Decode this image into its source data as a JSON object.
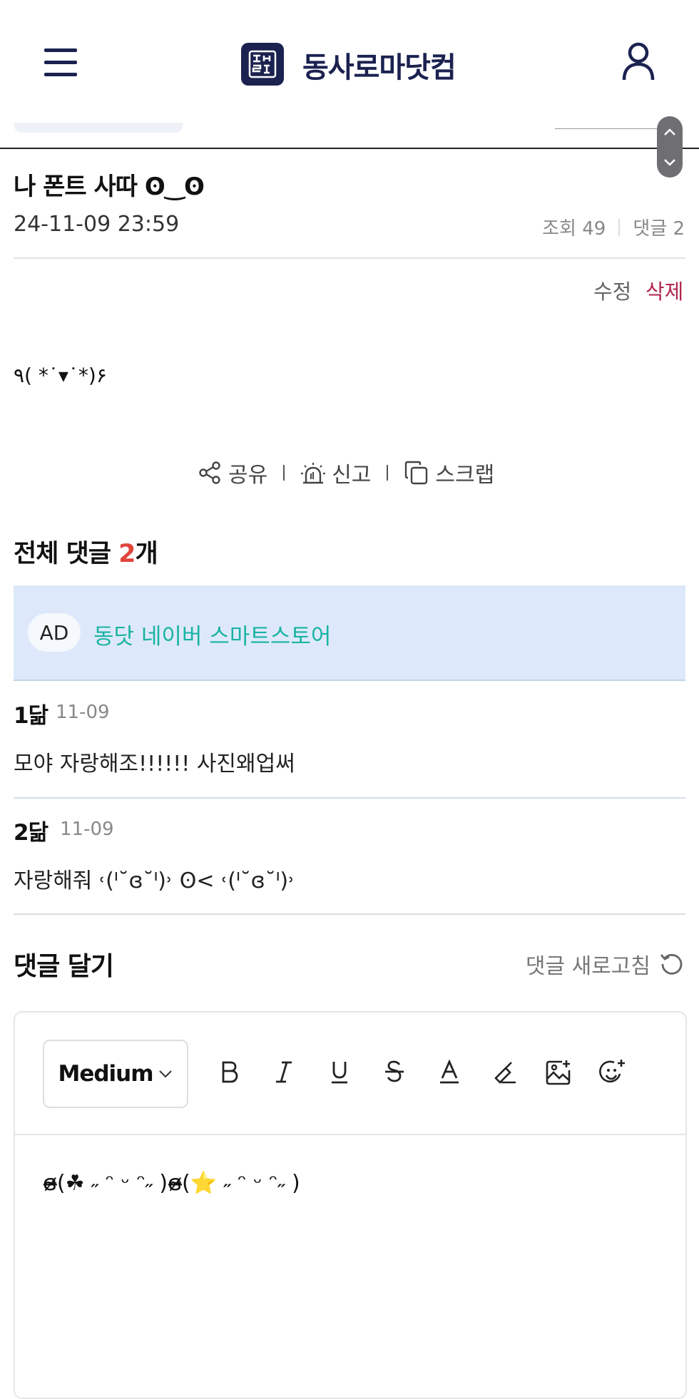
{
  "header": {
    "logo_mark": "동사\n로닷",
    "site_title": "동사로마닷컴"
  },
  "post": {
    "title": "나 폰트 사따 ʘ‿ʘ",
    "date": "24-11-09 23:59",
    "views_label": "조회 49",
    "comments_label": "댓글 2",
    "edit_label": "수정",
    "delete_label": "삭제",
    "body": "٩( *˙▾˙*)۶"
  },
  "actions": {
    "share": "공유",
    "report": "신고",
    "scrap": "스크랩"
  },
  "comments": {
    "heading_prefix": "전체 댓글 ",
    "count": "2",
    "heading_suffix": "개",
    "ad_badge": "AD",
    "ad_text": "동닷 네이버 스마트스토어",
    "items": [
      {
        "author": "1닮",
        "date": "11-09",
        "text": "모야 자랑해조!!!!!! 사진왜업써"
      },
      {
        "author": "2닮",
        "date": "11-09",
        "text": "자랑해줘 ˓(ᑊ˘ɞ˘ᑊ)˒ ʘ< ˓(ᑊ˘ɞ˘ᑊ)˒"
      }
    ]
  },
  "write": {
    "heading": "댓글 달기",
    "refresh_label": "댓글 새로고침",
    "font_size": "Medium",
    "content": "ɞ̴̶̷(☘︎ ˶ ᵔ ᵕ ᵔ˶ )ɞ̴̶̷(⭐ ˶ ᵔ ᵕ ᵔ˶ )"
  },
  "icons": {
    "menu": "hamburger-icon",
    "user": "user-icon",
    "share": "share-icon",
    "report": "siren-icon",
    "scrap": "copy-icon",
    "refresh": "refresh-icon"
  },
  "colors": {
    "brand": "#1b2250",
    "delete": "#b0264c",
    "count_accent": "#e0463d",
    "ad_link": "#19b3a3",
    "ad_bg": "#dde9fa"
  }
}
